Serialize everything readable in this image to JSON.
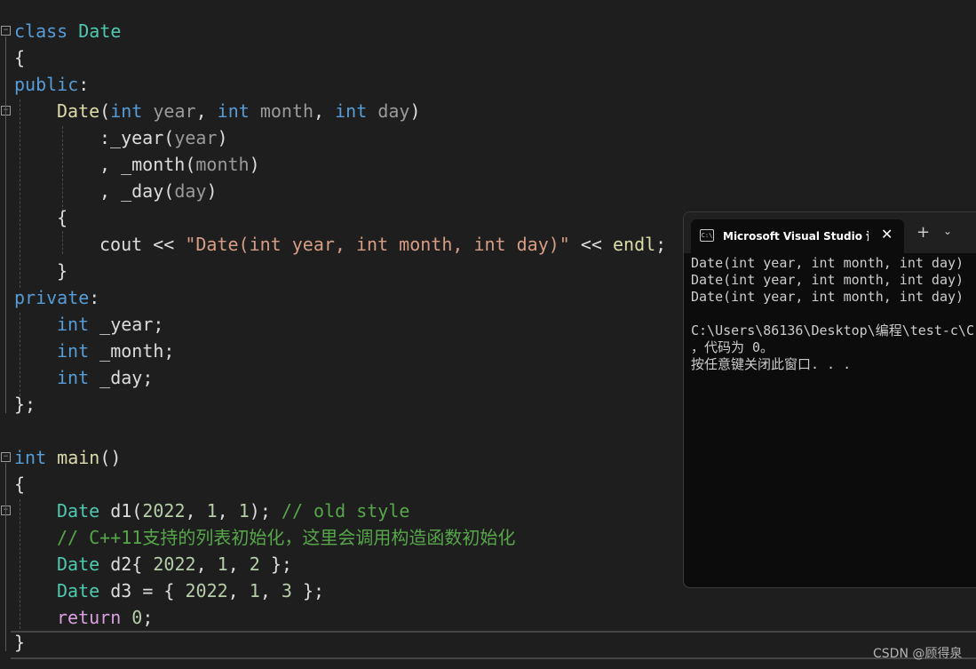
{
  "code": {
    "l1": [
      "class",
      " ",
      "Date"
    ],
    "l2": "{",
    "l3": [
      "public",
      ":"
    ],
    "l4": [
      "Date",
      "(",
      "int",
      " ",
      "year",
      ", ",
      "int",
      " ",
      "month",
      ", ",
      "int",
      " ",
      "day",
      ")"
    ],
    "l5": [
      ":",
      "_year",
      "(",
      "year",
      ")"
    ],
    "l6": [
      ", ",
      "_month",
      "(",
      "month",
      ")"
    ],
    "l7": [
      ", ",
      "_day",
      "(",
      "day",
      ")"
    ],
    "l8": "{",
    "l9": [
      "cout",
      " << ",
      "\"Date(int year, int month, int day)\"",
      " << ",
      "endl",
      ";"
    ],
    "l10": "}",
    "l11": [
      "private",
      ":"
    ],
    "l12": [
      "int",
      " _year;"
    ],
    "l13": [
      "int",
      " _month;"
    ],
    "l14": [
      "int",
      " _day;"
    ],
    "l15": "};",
    "l16": [
      "int",
      " ",
      "main",
      "()"
    ],
    "l17": "{",
    "l18": [
      "Date",
      " d1(",
      "2022",
      ", ",
      "1",
      ", ",
      "1",
      "); ",
      "// old style"
    ],
    "l19": "// C++11支持的列表初始化，这里会调用构造函数初始化",
    "l20": [
      "Date",
      " d2{ ",
      "2022",
      ", ",
      "1",
      ", ",
      "2",
      " };"
    ],
    "l21": [
      "Date",
      " d3 = { ",
      "2022",
      ", ",
      "1",
      ", ",
      "3",
      " };"
    ],
    "l22": [
      "return",
      " ",
      "0",
      ";"
    ],
    "l23": "}"
  },
  "terminal": {
    "tab_title": "Microsoft Visual Studio 调试控制台",
    "icon_label": "C:\\",
    "close_glyph": "✕",
    "new_tab_glyph": "+",
    "dropdown_glyph": "⌄",
    "lines": [
      "Date(int year, int month, int day)",
      "Date(int year, int month, int day)",
      "Date(int year, int month, int day)",
      "",
      "C:\\Users\\86136\\Desktop\\编程\\test-c\\C",
      "，代码为 0。",
      "按任意键关闭此窗口. . ."
    ]
  },
  "fold_glyph": "−",
  "watermark": "CSDN @顾得泉",
  "colors": {
    "background": "#1e1e1e",
    "keyword": "#569cd6",
    "type": "#4ec9b0",
    "function": "#dcdcaa",
    "parameter": "#9a9a9a",
    "string": "#d69d85",
    "comment": "#57a64a",
    "control": "#d8a0df",
    "terminal_bg": "#0c0c0c"
  }
}
